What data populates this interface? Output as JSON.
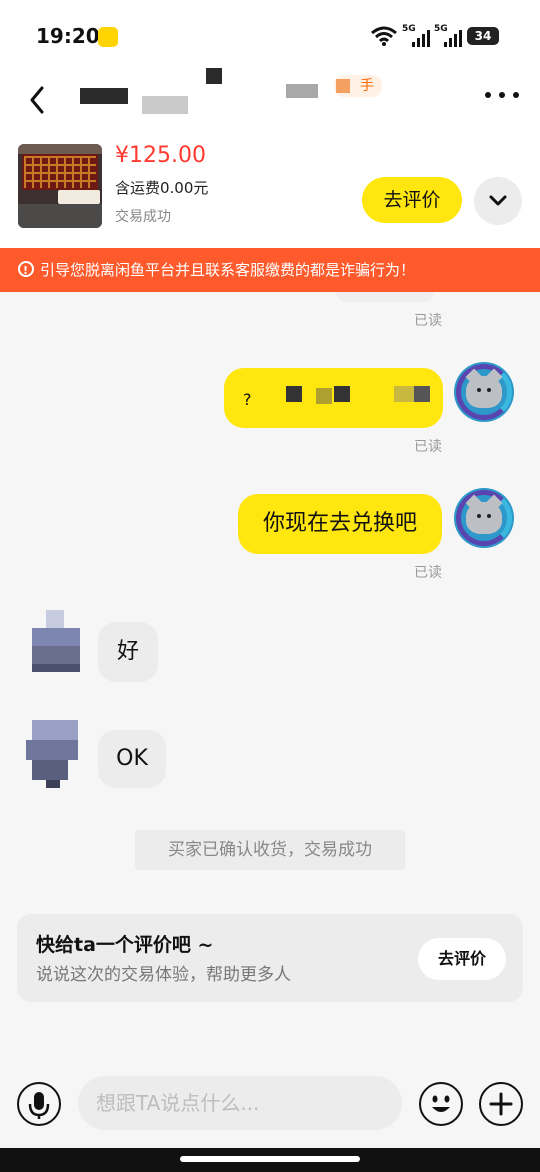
{
  "status_bar": {
    "time": "19:20",
    "network1": "5G",
    "network2": "5G",
    "battery": "34"
  },
  "header": {
    "tag_label": "手"
  },
  "product": {
    "price": "¥125.00",
    "shipping": "含运费0.00元",
    "status": "交易成功",
    "review_button": "去评价"
  },
  "warning": {
    "text": "引导您脱离闲鱼平台并且联系客服缴费的都是诈骗行为！"
  },
  "messages": [
    {
      "sender": "me",
      "text": "",
      "read_label": "已读"
    },
    {
      "sender": "me",
      "text": "",
      "read_label": "已读"
    },
    {
      "sender": "me",
      "text": "你现在去兑换吧",
      "read_label": "已读"
    },
    {
      "sender": "other",
      "text": "好"
    },
    {
      "sender": "other",
      "text": "OK"
    }
  ],
  "system_message": "买家已确认收货，交易成功",
  "review_card": {
    "title": "快给ta一个评价吧 ~",
    "subtitle": "说说这次的交易体验，帮助更多人",
    "button": "去评价"
  },
  "input": {
    "placeholder": "想跟TA说点什么..."
  },
  "colors": {
    "accent_yellow": "#ffe60f",
    "price_red": "#ff3b30",
    "warning_orange": "#ff5a2c"
  }
}
